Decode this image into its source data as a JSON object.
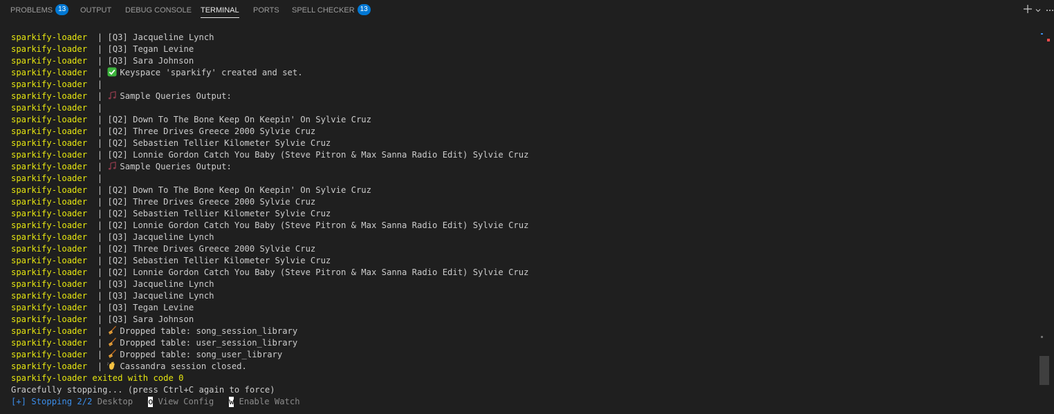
{
  "panel_tabs": [
    {
      "label": "PROBLEMS",
      "badge": "13"
    },
    {
      "label": "OUTPUT"
    },
    {
      "label": "DEBUG CONSOLE"
    },
    {
      "label": "TERMINAL",
      "active": true
    },
    {
      "label": "PORTS"
    },
    {
      "label": "SPELL CHECKER",
      "badge": "13"
    }
  ],
  "panel_actions": {
    "new_terminal_icon": "plus-icon",
    "dropdown_icon": "chevron-down-icon",
    "more_icon": "ellipsis-icon"
  },
  "terminal": {
    "service": "sparkify-loader",
    "separator": "|",
    "lines": [
      {
        "text": "[Q3] Jacqueline Lynch"
      },
      {
        "text": "[Q3] Tegan Levine"
      },
      {
        "text": "[Q3] Sara Johnson"
      },
      {
        "icon": "check-mark-icon",
        "text": "Keyspace 'sparkify' created and set."
      },
      {
        "text": ""
      },
      {
        "icon": "music-note-icon",
        "text": "Sample Queries Output:"
      },
      {
        "text": ""
      },
      {
        "text": "[Q2] Down To The Bone Keep On Keepin' On Sylvie Cruz"
      },
      {
        "text": "[Q2] Three Drives Greece 2000 Sylvie Cruz"
      },
      {
        "text": "[Q2] Sebastien Tellier Kilometer Sylvie Cruz"
      },
      {
        "text": "[Q2] Lonnie Gordon Catch You Baby (Steve Pitron & Max Sanna Radio Edit) Sylvie Cruz"
      },
      {
        "icon": "music-note-icon",
        "text": "Sample Queries Output:"
      },
      {
        "text": ""
      },
      {
        "text": "[Q2] Down To The Bone Keep On Keepin' On Sylvie Cruz"
      },
      {
        "text": "[Q2] Three Drives Greece 2000 Sylvie Cruz"
      },
      {
        "text": "[Q2] Sebastien Tellier Kilometer Sylvie Cruz"
      },
      {
        "text": "[Q2] Lonnie Gordon Catch You Baby (Steve Pitron & Max Sanna Radio Edit) Sylvie Cruz"
      },
      {
        "text": "[Q3] Jacqueline Lynch"
      },
      {
        "text": "[Q2] Three Drives Greece 2000 Sylvie Cruz"
      },
      {
        "text": "[Q2] Sebastien Tellier Kilometer Sylvie Cruz"
      },
      {
        "text": "[Q2] Lonnie Gordon Catch You Baby (Steve Pitron & Max Sanna Radio Edit) Sylvie Cruz"
      },
      {
        "text": "[Q3] Jacqueline Lynch"
      },
      {
        "text": "[Q3] Jacqueline Lynch"
      },
      {
        "text": "[Q3] Tegan Levine"
      },
      {
        "text": "[Q3] Sara Johnson"
      },
      {
        "icon": "broom-icon",
        "text": "Dropped table: song_session_library"
      },
      {
        "icon": "broom-icon",
        "text": "Dropped table: user_session_library"
      },
      {
        "icon": "broom-icon",
        "text": "Dropped table: song_user_library"
      },
      {
        "icon": "waving-hand-icon",
        "text": "Cassandra session closed."
      }
    ],
    "exit_line": "sparkify-loader exited with code 0",
    "graceful_line": "Gracefully stopping... (press Ctrl+C again to force)",
    "status_line": {
      "prefix": "[+] Stopping 2/2",
      "target": "Desktop",
      "shortcut_1_key": "o",
      "shortcut_1_label": "View Config",
      "shortcut_2_key": "w",
      "shortcut_2_label": "Enable Watch"
    }
  },
  "colors": {
    "background": "#1f1f1f",
    "service_name": "#e5e510",
    "text": "#cccccc",
    "status_blue": "#3b8eea",
    "badge": "#0078d4"
  }
}
